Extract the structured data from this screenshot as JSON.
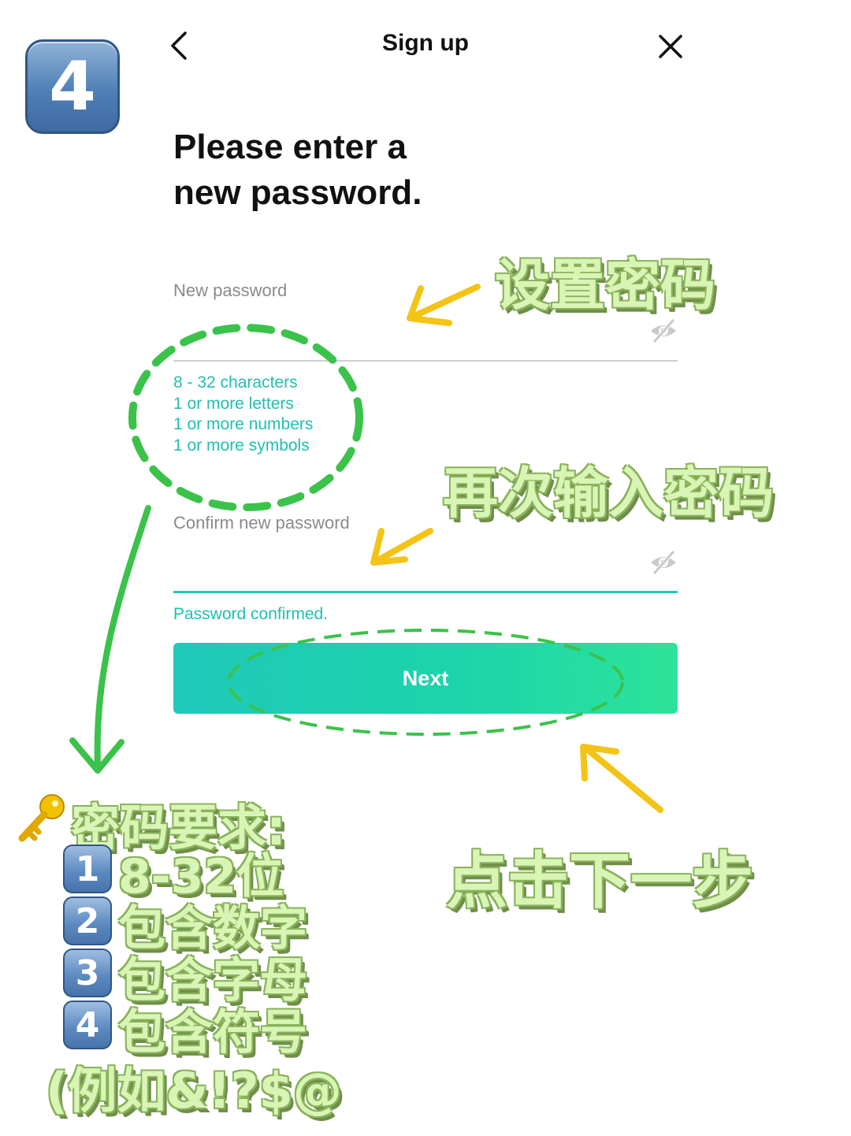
{
  "step_badge": "4",
  "nav": {
    "title": "Sign up",
    "back_icon": "chevron-left-icon",
    "close_icon": "close-icon"
  },
  "headline": {
    "line1": "Please enter a",
    "line2": "new password."
  },
  "new_password": {
    "label": "New password",
    "value": ""
  },
  "requirements": [
    "8 - 32 characters",
    "1 or more letters",
    "1 or more numbers",
    "1 or more symbols"
  ],
  "confirm_password": {
    "label": "Confirm new password",
    "value": "",
    "status": "Password confirmed."
  },
  "next_label": "Next",
  "annotations": {
    "set_password": "设置密码",
    "reenter_password": "再次输入密码",
    "click_next": "点击下一步",
    "rules_title": "密码要求:",
    "rules": [
      {
        "num": "1",
        "text": "8-32位"
      },
      {
        "num": "2",
        "text": "包含数字"
      },
      {
        "num": "3",
        "text": "包含字母"
      },
      {
        "num": "4",
        "text": "包含符号"
      }
    ],
    "example": "(例如&!?$@"
  },
  "colors": {
    "accent": "#20bfb0",
    "arrow_yellow": "#f3c316",
    "arrow_green": "#3bc24a",
    "annotation_fill": "#d9f5b6"
  }
}
